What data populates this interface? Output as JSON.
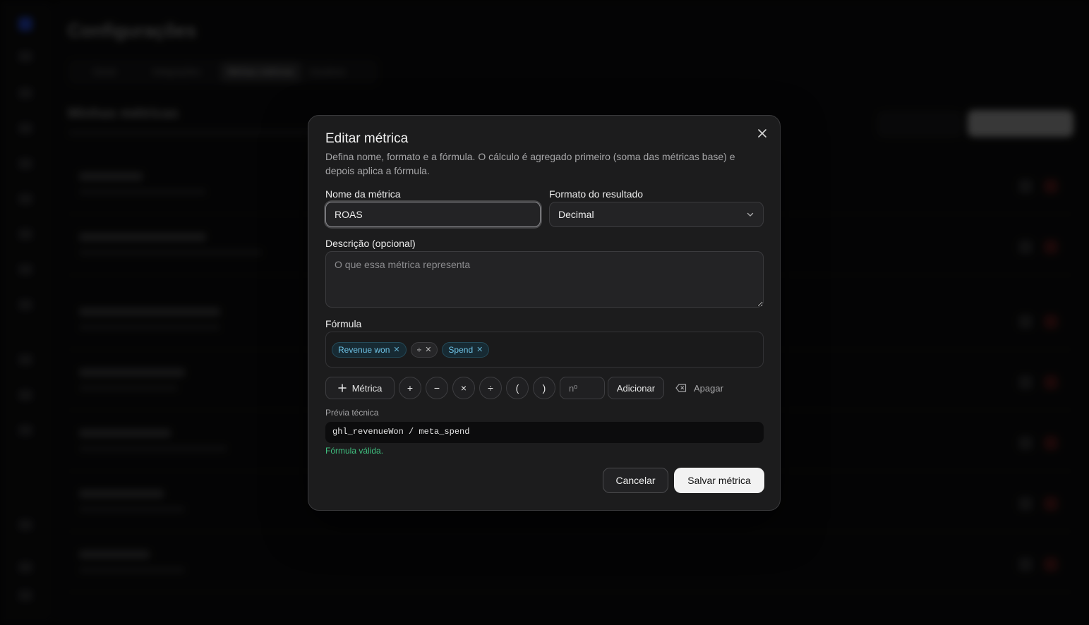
{
  "background": {
    "page_title": "Configurações",
    "tabs": [
      "Geral",
      "Integrações",
      "Minhas métricas",
      "Usuários"
    ],
    "section_title": "Minhas métricas",
    "button_secondary": "Importar",
    "button_primary": "Nova métrica"
  },
  "dialog": {
    "title": "Editar métrica",
    "description": "Defina nome, formato e a fórmula. O cálculo é agregado primeiro (soma das métricas base) e depois aplica a fórmula.",
    "name_label": "Nome da métrica",
    "name_value": "ROAS",
    "format_label": "Formato do resultado",
    "format_value": "Decimal",
    "desc_label": "Descrição (opcional)",
    "desc_placeholder": "O que essa métrica representa",
    "formula_label": "Fórmula",
    "formula_tokens": [
      {
        "label": "Revenue won",
        "kind": "metric"
      },
      {
        "label": "÷",
        "kind": "operator"
      },
      {
        "label": "Spend",
        "kind": "metric"
      }
    ],
    "toolbar": {
      "metric_label": "Métrica",
      "plus": "+",
      "minus": "−",
      "times": "×",
      "divide": "÷",
      "open_paren": "(",
      "close_paren": ")",
      "number_placeholder": "nº",
      "add_label": "Adicionar",
      "erase_label": "Apagar"
    },
    "preview_label": "Prévia técnica",
    "preview_code": "ghl_revenueWon / meta_spend",
    "valid_text": "Fórmula válida.",
    "cancel_label": "Cancelar",
    "save_label": "Salvar métrica"
  },
  "icons": {
    "close": "close-icon",
    "chevron": "chevron-down-icon",
    "plus": "plus-icon",
    "backspace": "backspace-icon"
  },
  "colors": {
    "chip_metric": "#6fc3e6",
    "valid": "#3fbf7f",
    "primary_button": "#f2f2f2"
  }
}
